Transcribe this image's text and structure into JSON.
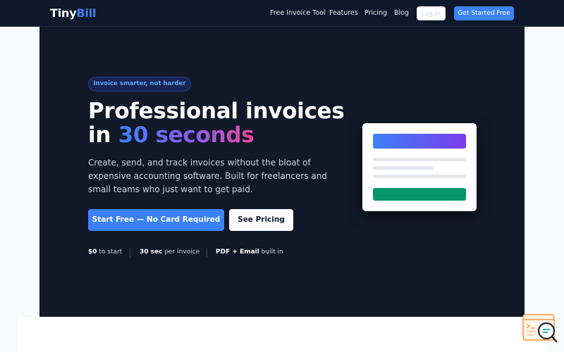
{
  "brand": {
    "name_part1": "Tiny",
    "name_part2": "Bill"
  },
  "nav": {
    "links": [
      "Free Invoice Tool",
      "Features",
      "Pricing",
      "Blog"
    ],
    "login_label": "Log In",
    "get_started_label": "Get Started Free"
  },
  "hero": {
    "badge": "Invoice smarter, not harder",
    "headline_line1": "Professional invoices",
    "headline_line2_prefix": "in ",
    "headline_line2_highlight": "30 seconds",
    "subtext": "Create, send, and track invoices without the bloat of expensive accounting software. Built for freelancers and small teams who just want to get paid.",
    "primary_cta": "Start Free — No Card Required",
    "secondary_cta": "See Pricing",
    "stats": [
      {
        "value": "$0",
        "label": " to start"
      },
      {
        "value": "30 sec",
        "label": " per invoice"
      },
      {
        "value": "PDF + Email",
        "label": " built in"
      }
    ]
  },
  "widget": {
    "icon": "search-chat-icon"
  },
  "colors": {
    "navbar_bg": "#0f172a",
    "hero_bg": "#111827",
    "primary": "#3b82f6",
    "accent_purple": "#7c3aed",
    "accent_pink": "#ec4899",
    "success": "#059669",
    "widget_orange": "#f97316"
  }
}
